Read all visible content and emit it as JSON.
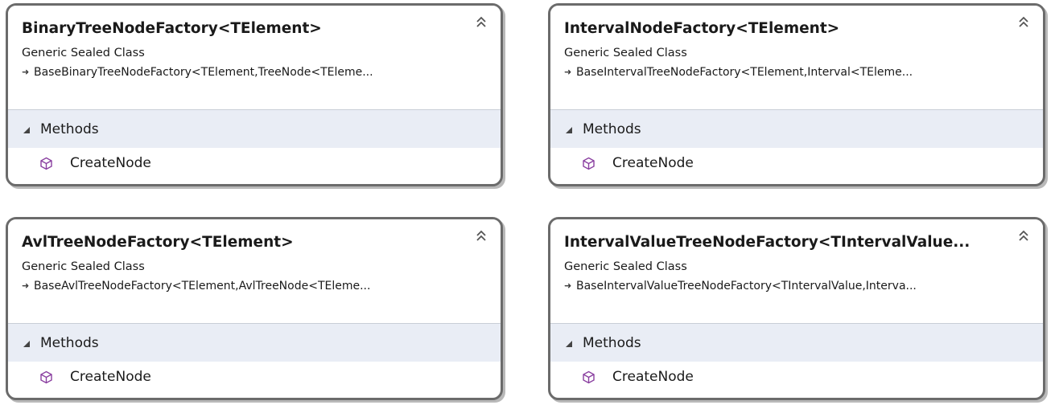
{
  "classes": [
    {
      "name": "BinaryTreeNodeFactory",
      "type_params": "<TElement>",
      "stereotype": "Generic Sealed Class",
      "base_prefix": "BaseBinaryTreeNodeFactory<TElement, ",
      "base_suffix": " TreeNode<TEleme...",
      "section": "Methods",
      "members": [
        "CreateNode"
      ]
    },
    {
      "name": "IntervalNodeFactory",
      "type_params": "<TElement>",
      "stereotype": "Generic Sealed Class",
      "base_prefix": "BaseIntervalTreeNodeFactory<TElement, ",
      "base_suffix": " Interval<TEleme...",
      "section": "Methods",
      "members": [
        "CreateNode"
      ]
    },
    {
      "name": "AvlTreeNodeFactory",
      "type_params": "<TElement>",
      "stereotype": "Generic Sealed Class",
      "base_prefix": "BaseAvlTreeNodeFactory<TElement, ",
      "base_suffix": " AvlTreeNode<TEleme...",
      "section": "Methods",
      "members": [
        "CreateNode"
      ]
    },
    {
      "name": "IntervalValueTreeNodeFactory",
      "type_params": "<TIntervalValue...",
      "stereotype": "Generic Sealed Class",
      "base_prefix": "BaseIntervalValueTreeNodeFactory<TIntervalValue, ",
      "base_suffix": " Interva...",
      "section": "Methods",
      "members": [
        "CreateNode"
      ]
    }
  ],
  "icons": {
    "collapse": "double-chevron-up-icon",
    "inherit": "inheritance-arrow-icon",
    "section_toggle": "expanded-triangle-icon",
    "method": "method-cube-icon"
  },
  "colors": {
    "border": "#6b6b6b",
    "section_bg": "#e9edf5",
    "method_icon": "#8a3fa0"
  }
}
